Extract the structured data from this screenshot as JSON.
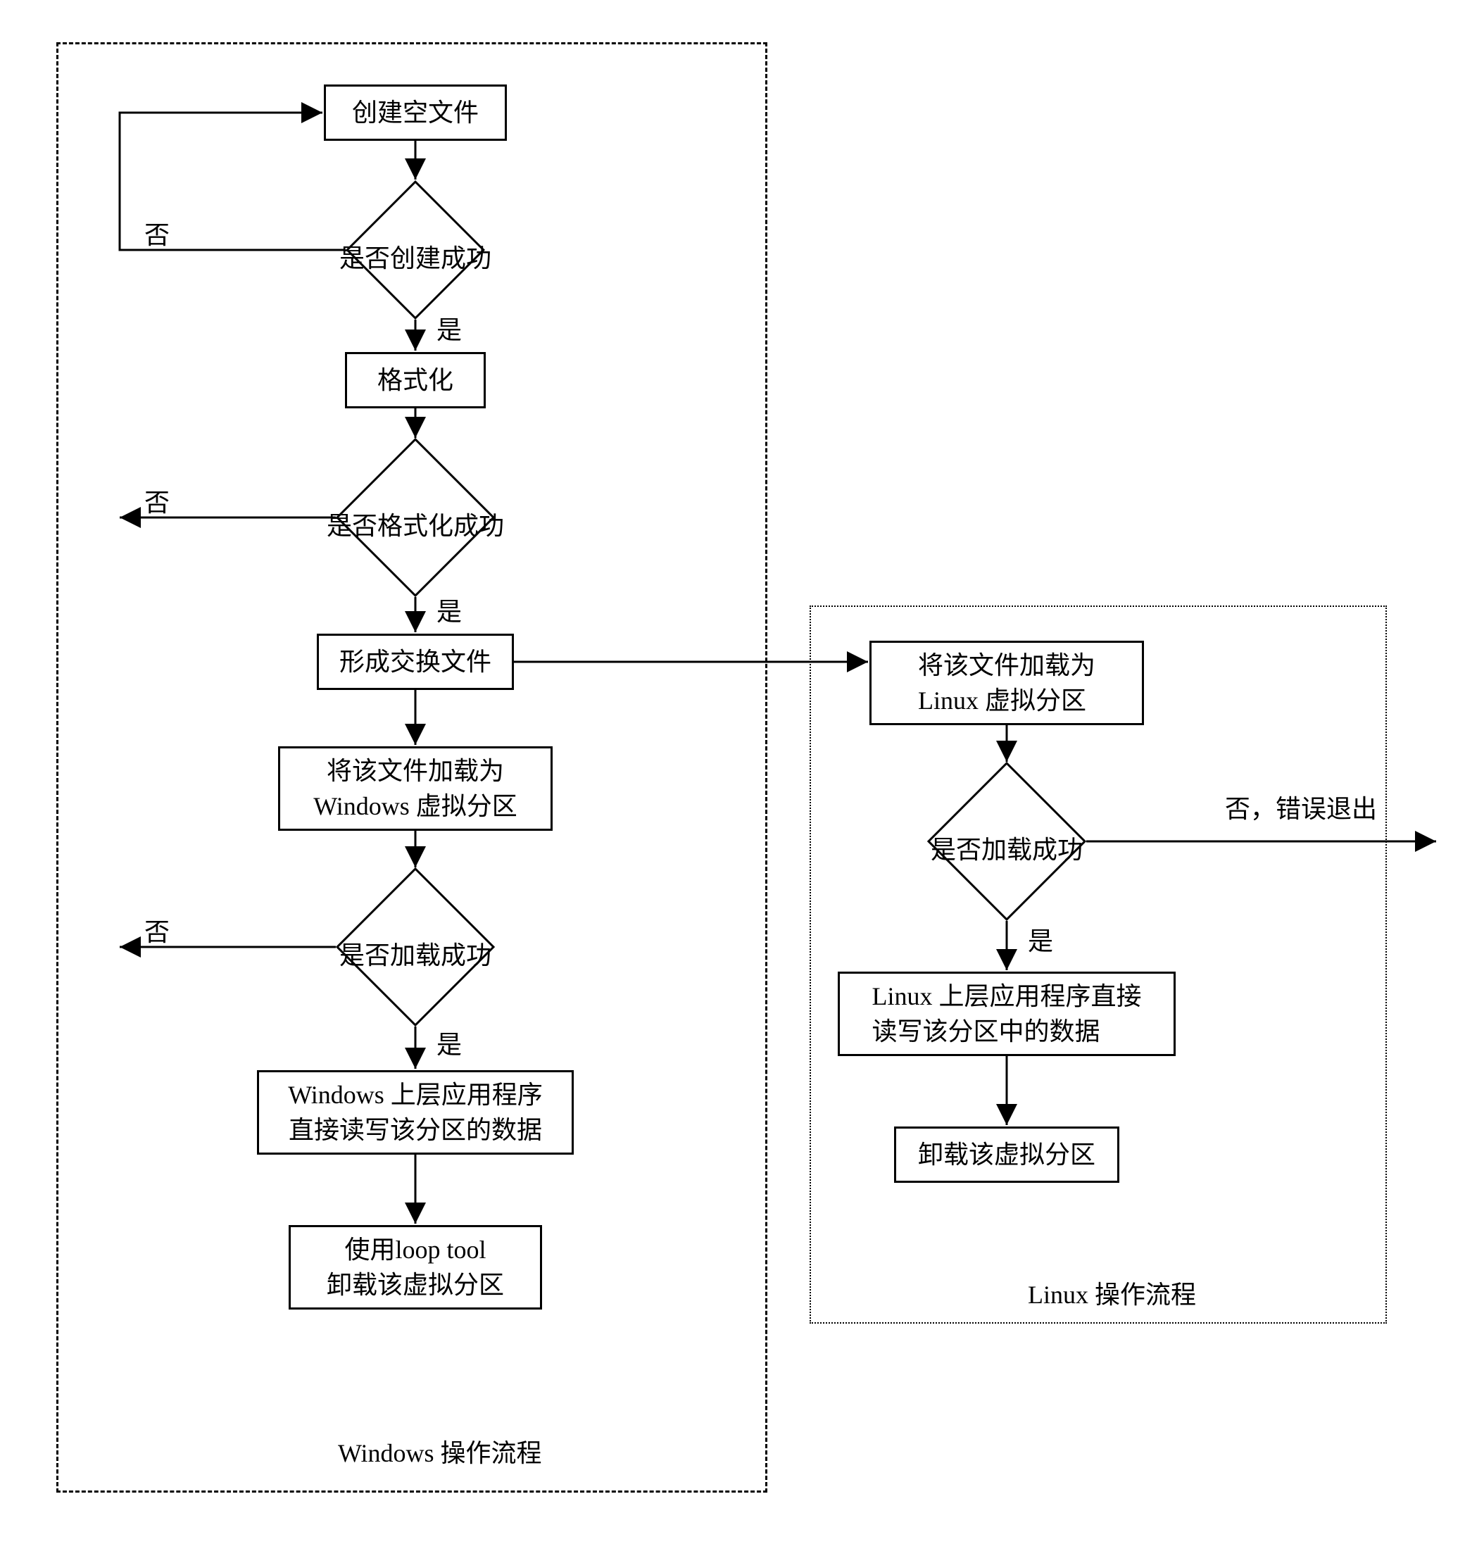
{
  "windows_panel_label": "Windows 操作流程",
  "linux_panel_label": "Linux 操作流程",
  "windows": {
    "n1": "创建空文件",
    "d1": "是否创建成功",
    "n2": "格式化",
    "d2": "是否格式化成功",
    "n3": "形成交换文件",
    "n4": "将该文件加载为\nWindows 虚拟分区",
    "d3": "是否加载成功",
    "n5": "Windows 上层应用程序\n直接读写该分区的数据",
    "n6": "使用loop tool\n卸载该虚拟分区"
  },
  "linux": {
    "n1": "将该文件加载为\nLinux 虚拟分区",
    "d1": "是否加载成功",
    "n2": "Linux 上层应用程序直接\n读写该分区中的数据",
    "n3": "卸载该虚拟分区"
  },
  "edges": {
    "yes": "是",
    "no": "否",
    "no_exit": "否，错误退出"
  }
}
